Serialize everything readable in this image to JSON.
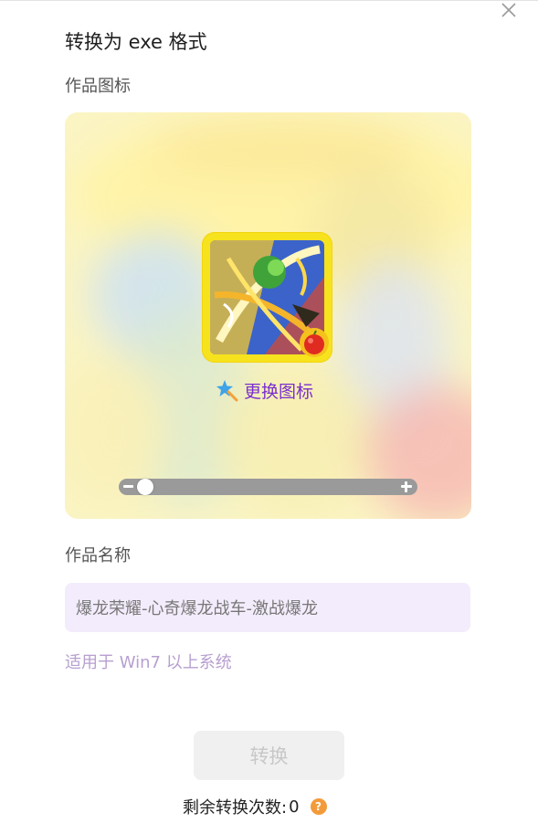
{
  "dialog": {
    "title": "转换为 exe 格式",
    "close_icon": "close-icon"
  },
  "icon_section": {
    "label": "作品图标",
    "change_label": "更换图标",
    "change_icon": "magic-wand-icon",
    "badge_icon": "apple-badge-icon",
    "zoom": {
      "minus_icon": "minus-icon",
      "plus_icon": "plus-icon",
      "level_fraction": 0.07
    },
    "colors": {
      "frame": "#f7e21e",
      "link": "#7b2fd0"
    }
  },
  "name_section": {
    "label": "作品名称",
    "value": "爆龙荣耀-心奇爆龙战车-激战爆龙"
  },
  "compat_note": "适用于 Win7 以上系统",
  "convert_button": "转换",
  "remaining": {
    "label": "剩余转换次数:",
    "count": "0",
    "help_icon": "?"
  }
}
